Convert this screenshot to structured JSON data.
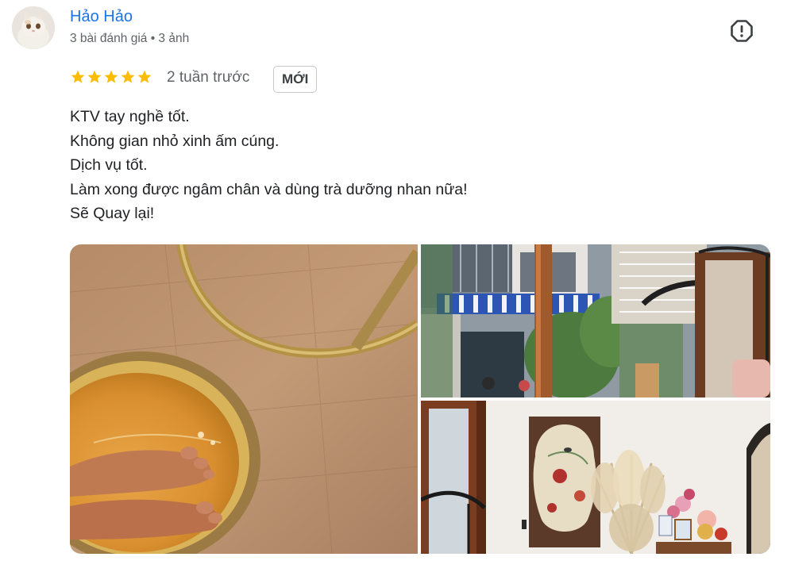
{
  "reviewer": {
    "name": "Hảo Hảo",
    "meta": "3 bài đánh giá • 3 ảnh",
    "avatar_icon": "cat-avatar-icon"
  },
  "review": {
    "rating": 5,
    "rating_max": 5,
    "time": "2 tuần trước",
    "badge": "MỚI",
    "lines": [
      "KTV tay nghề tốt.",
      "Không gian nhỏ xinh ấm cúng.",
      "Dịch vụ tốt.",
      "Làm xong được ngâm chân và dùng trà dưỡng nhan nữa!",
      "Sẽ Quay lại!"
    ]
  },
  "actions": {
    "report_icon": "report-icon"
  },
  "photos": [
    "foot-soak-photo",
    "street-view-photo",
    "spa-interior-photo"
  ],
  "colors": {
    "name": "#1a73e8",
    "star": "#fbbc04",
    "meta": "#5f6368",
    "text": "#202124"
  }
}
